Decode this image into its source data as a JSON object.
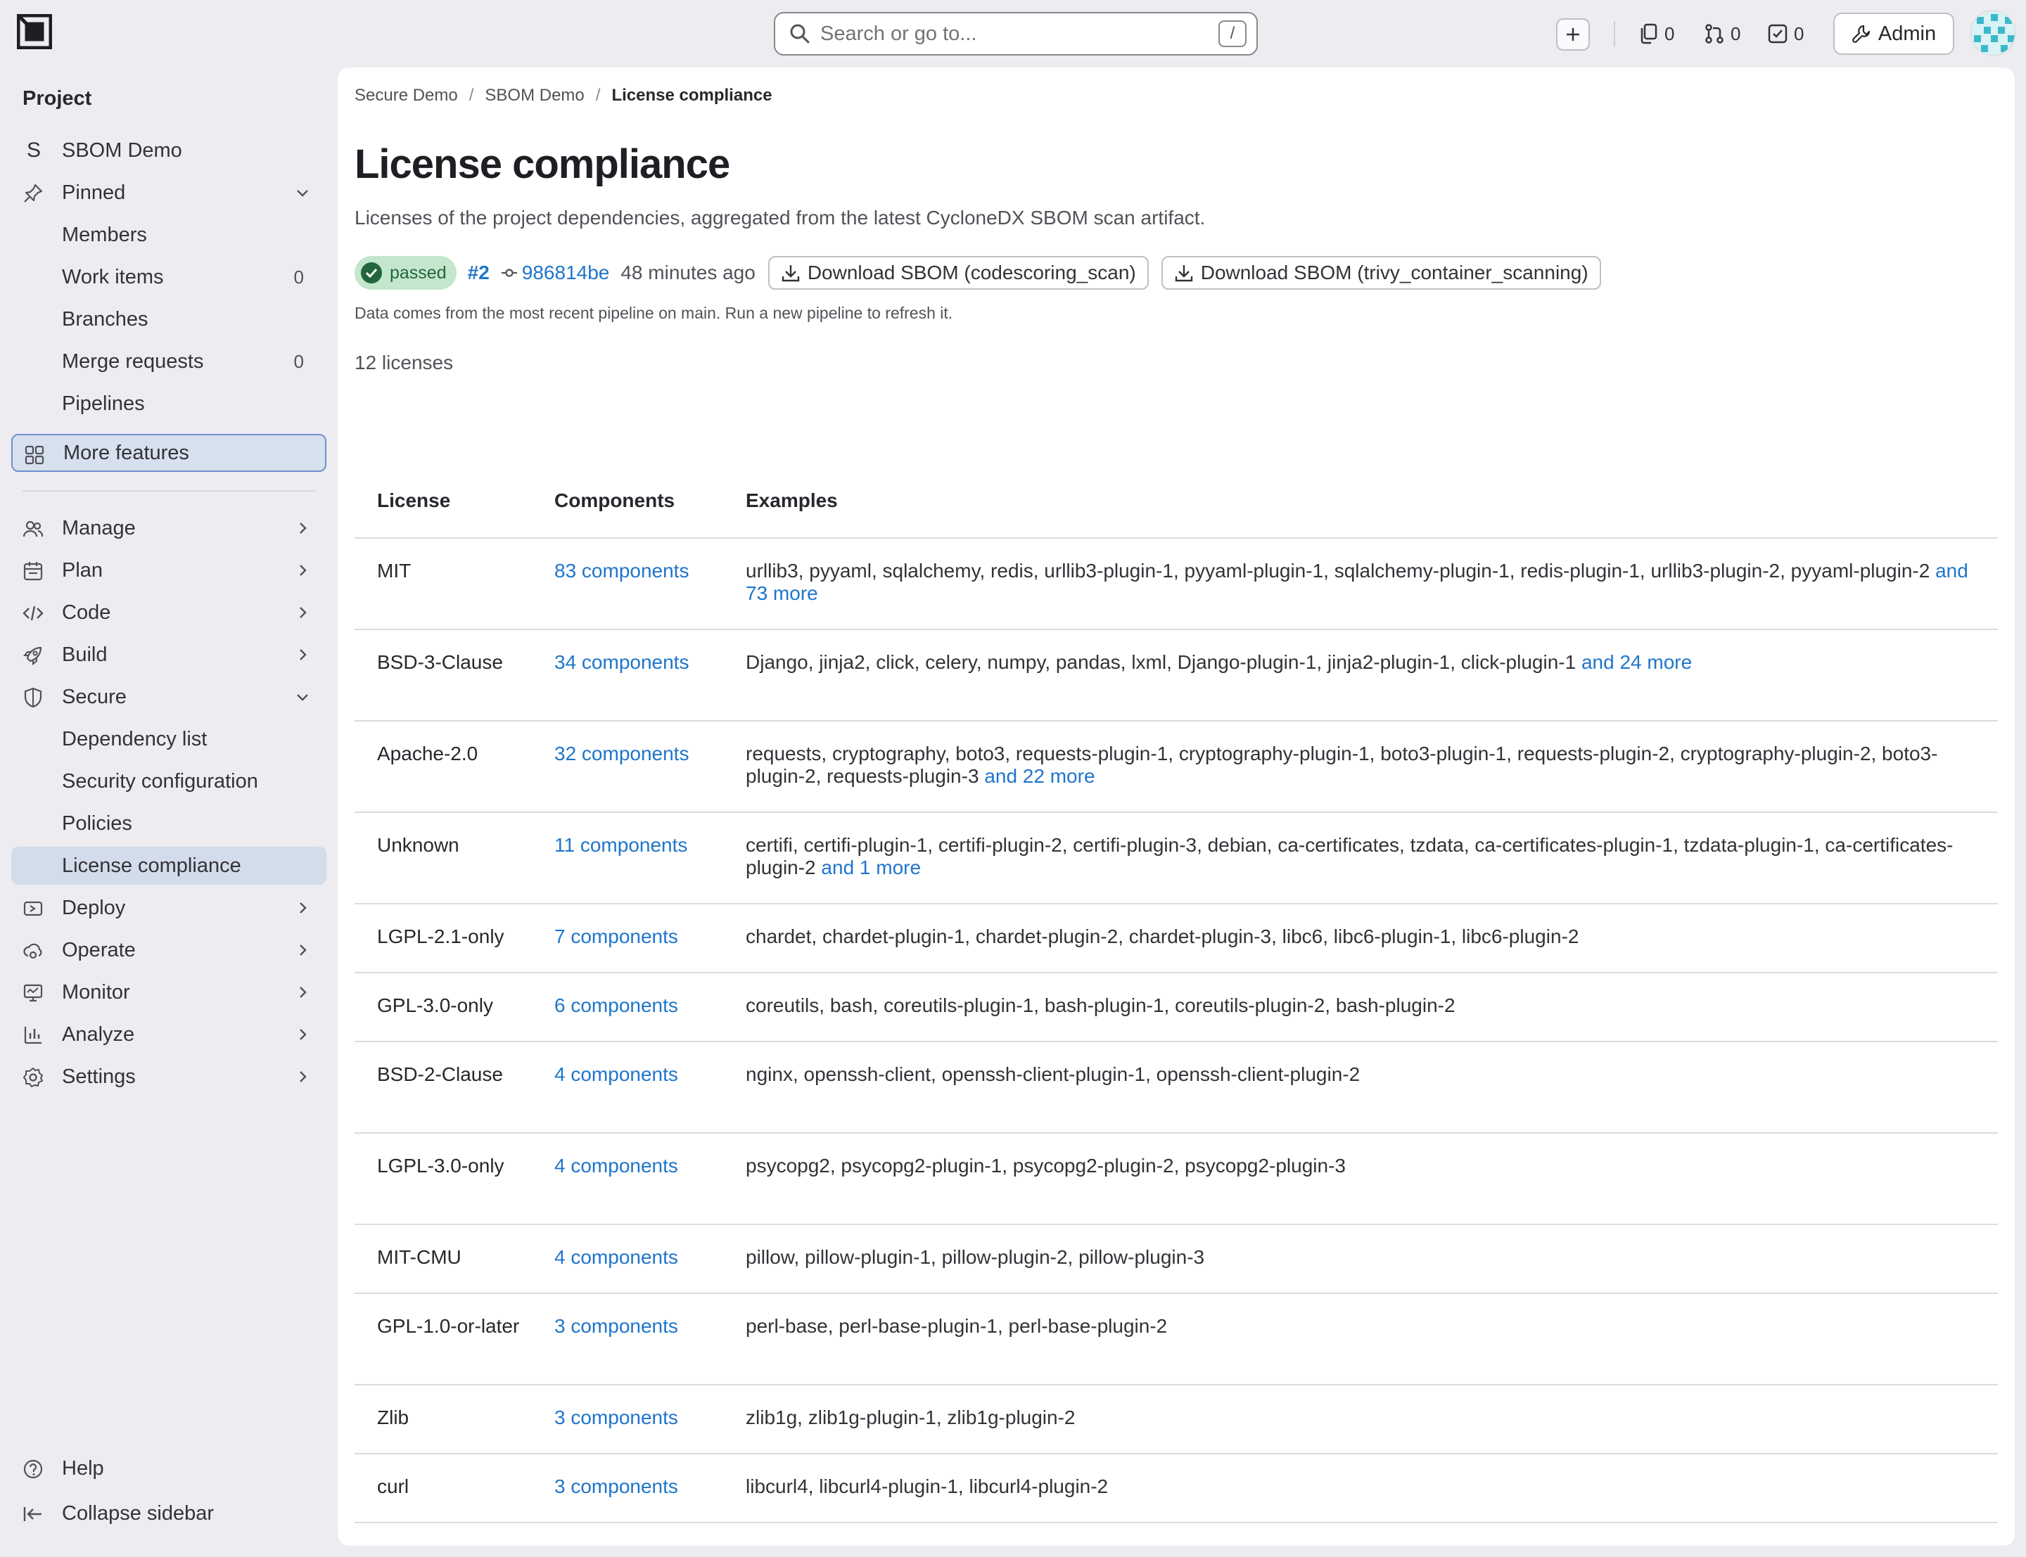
{
  "search": {
    "placeholder": "Search or go to...",
    "shortcut": "/"
  },
  "topbar": {
    "issues_count": "0",
    "mr_count": "0",
    "todo_count": "0",
    "admin_label": "Admin"
  },
  "sidebar": {
    "heading": "Project",
    "project": {
      "initial": "S",
      "name": "SBOM Demo"
    },
    "pinned": {
      "label": "Pinned",
      "items": [
        {
          "label": "Members",
          "count": ""
        },
        {
          "label": "Work items",
          "count": "0"
        },
        {
          "label": "Branches",
          "count": ""
        },
        {
          "label": "Merge requests",
          "count": "0"
        },
        {
          "label": "Pipelines",
          "count": ""
        }
      ]
    },
    "more_features": "More features",
    "sections": {
      "manage": "Manage",
      "plan": "Plan",
      "code": "Code",
      "build": "Build",
      "secure": "Secure",
      "deploy": "Deploy",
      "operate": "Operate",
      "monitor": "Monitor",
      "analyze": "Analyze",
      "settings": "Settings"
    },
    "secure_items": [
      "Dependency list",
      "Security configuration",
      "Policies",
      "License compliance"
    ],
    "help": "Help",
    "collapse": "Collapse sidebar"
  },
  "breadcrumb": {
    "group": "Secure Demo",
    "project": "SBOM Demo",
    "current": "License compliance"
  },
  "page": {
    "title": "License compliance",
    "description": "Licenses of the project dependencies, aggregated from the latest CycloneDX SBOM scan artifact.",
    "pipeline": {
      "status": "passed",
      "id": "#2",
      "commit": "986814be",
      "time": "48 minutes ago",
      "download_1": "Download SBOM (codescoring_scan)",
      "download_2": "Download SBOM (trivy_container_scanning)"
    },
    "note": "Data comes from the most recent pipeline on main. Run a new pipeline to refresh it.",
    "license_count": "12 licenses"
  },
  "table": {
    "headers": {
      "license": "License",
      "components": "Components",
      "examples": "Examples"
    },
    "rows": [
      {
        "license": "MIT",
        "components": "83 components",
        "examples": "urllib3, pyyaml, sqlalchemy, redis, urllib3-plugin-1, pyyaml-plugin-1, sqlalchemy-plugin-1, redis-plugin-1, urllib3-plugin-2, pyyaml-plugin-2",
        "more": "and 73 more"
      },
      {
        "license": "BSD-3-Clause",
        "components": "34 components",
        "examples": "Django, jinja2, click, celery, numpy, pandas, lxml, Django-plugin-1, jinja2-plugin-1, click-plugin-1",
        "more": "and 24 more"
      },
      {
        "license": "Apache-2.0",
        "components": "32 components",
        "examples": "requests, cryptography, boto3, requests-plugin-1, cryptography-plugin-1, boto3-plugin-1, requests-plugin-2, cryptography-plugin-2, boto3-plugin-2, requests-plugin-3",
        "more": "and 22 more"
      },
      {
        "license": "Unknown",
        "components": "11 components",
        "examples": "certifi, certifi-plugin-1, certifi-plugin-2, certifi-plugin-3, debian, ca-certificates, tzdata, ca-certificates-plugin-1, tzdata-plugin-1, ca-certificates-plugin-2",
        "more": "and 1 more"
      },
      {
        "license": "LGPL-2.1-only",
        "components": "7 components",
        "examples": "chardet, chardet-plugin-1, chardet-plugin-2, chardet-plugin-3, libc6, libc6-plugin-1, libc6-plugin-2",
        "more": ""
      },
      {
        "license": "GPL-3.0-only",
        "components": "6 components",
        "examples": "coreutils, bash, coreutils-plugin-1, bash-plugin-1, coreutils-plugin-2, bash-plugin-2",
        "more": ""
      },
      {
        "license": "BSD-2-Clause",
        "components": "4 components",
        "examples": "nginx, openssh-client, openssh-client-plugin-1, openssh-client-plugin-2",
        "more": ""
      },
      {
        "license": "LGPL-3.0-only",
        "components": "4 components",
        "examples": "psycopg2, psycopg2-plugin-1, psycopg2-plugin-2, psycopg2-plugin-3",
        "more": ""
      },
      {
        "license": "MIT-CMU",
        "components": "4 components",
        "examples": "pillow, pillow-plugin-1, pillow-plugin-2, pillow-plugin-3",
        "more": ""
      },
      {
        "license": "GPL-1.0-or-later",
        "components": "3 components",
        "examples": "perl-base, perl-base-plugin-1, perl-base-plugin-2",
        "more": ""
      },
      {
        "license": "Zlib",
        "components": "3 components",
        "examples": "zlib1g, zlib1g-plugin-1, zlib1g-plugin-2",
        "more": ""
      },
      {
        "license": "curl",
        "components": "3 components",
        "examples": "libcurl4, libcurl4-plugin-1, libcurl4-plugin-2",
        "more": ""
      }
    ]
  },
  "colors": {
    "link": "#1f75cb",
    "passed_bg": "#c3e6cd",
    "passed_fg": "#108548",
    "sidebar_bg": "#ececf1",
    "active_bg": "#d3dcea"
  }
}
